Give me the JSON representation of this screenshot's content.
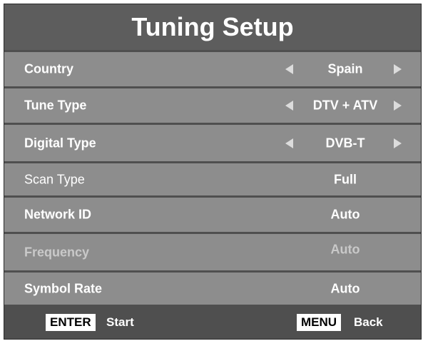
{
  "title": "Tuning Setup",
  "rows": [
    {
      "label": "Country",
      "value": "Spain"
    },
    {
      "label": "Tune Type",
      "value": "DTV + ATV"
    },
    {
      "label": "Digital Type",
      "value": "DVB-T"
    },
    {
      "label": "Scan Type",
      "value": "Full"
    },
    {
      "label": "Network ID",
      "value": "Auto"
    },
    {
      "label": "Frequency",
      "value": "Auto"
    },
    {
      "label": "Symbol Rate",
      "value": "Auto"
    }
  ],
  "footer": {
    "enter_key": "ENTER",
    "enter_label": "Start",
    "menu_key": "MENU",
    "menu_label": "Back"
  },
  "colors": {
    "panel": "#4f4f4f",
    "row": "#8d8d8d",
    "text": "#ffffff",
    "dim_text": "#c9c9c9"
  },
  "icons": [
    "arrow-left-icon",
    "arrow-right-icon"
  ]
}
